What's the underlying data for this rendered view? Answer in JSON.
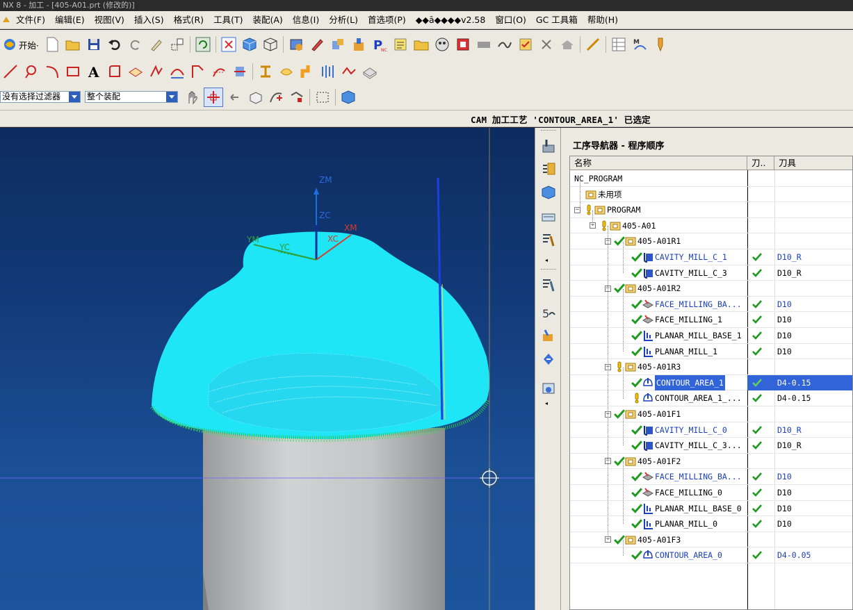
{
  "window": {
    "title": "NX 8 - 加工 - [405-A01.prt (修改的)]"
  },
  "menu": [
    "文件(F)",
    "编辑(E)",
    "视图(V)",
    "插入(S)",
    "格式(R)",
    "工具(T)",
    "装配(A)",
    "信息(I)",
    "分析(L)",
    "首选项(P)",
    "◆◆ā◆◆◆◆v2.58",
    "窗口(O)",
    "GC 工具箱",
    "帮助(H)"
  ],
  "toolbar": {
    "start_label": "开始·",
    "filter_combo": "没有选择过滤器",
    "assembly_combo": "整个装配"
  },
  "status": {
    "message": "CAM 加工工艺 'CONTOUR_AREA_1' 已选定"
  },
  "viewport": {
    "axis_labels": {
      "zm": "ZM",
      "zc": "ZC",
      "xm": "XM",
      "xc": "XC",
      "ym": "YM",
      "yc": "YC"
    }
  },
  "navigator": {
    "title": "工序导航器 - 程序顺序",
    "columns": [
      "名称",
      "刀..",
      "刀具"
    ],
    "rows": [
      {
        "level": 0,
        "label": "NC_PROGRAM",
        "kind": "root",
        "status": "",
        "check": false,
        "tool": "",
        "blue": false
      },
      {
        "level": 1,
        "label": "未用项",
        "kind": "group",
        "status": "",
        "check": false,
        "tool": "",
        "blue": false
      },
      {
        "level": 1,
        "label": "PROGRAM",
        "kind": "group",
        "status": "warn",
        "check": false,
        "tool": "",
        "blue": false,
        "expander": "−"
      },
      {
        "level": 2,
        "label": "405-A01",
        "kind": "group",
        "status": "warn",
        "check": false,
        "tool": "",
        "blue": false,
        "expander": "−"
      },
      {
        "level": 3,
        "label": "405-A01R1",
        "kind": "group",
        "status": "ok",
        "check": false,
        "tool": "",
        "blue": false,
        "expander": "−"
      },
      {
        "level": 4,
        "label": "CAVITY_MILL_C_1",
        "kind": "cavity",
        "status": "ok",
        "check": true,
        "tool": "D10_R",
        "blue": true
      },
      {
        "level": 4,
        "label": "CAVITY_MILL_C_3",
        "kind": "cavity",
        "status": "ok",
        "check": true,
        "tool": "D10_R",
        "blue": false
      },
      {
        "level": 3,
        "label": "405-A01R2",
        "kind": "group",
        "status": "ok",
        "check": false,
        "tool": "",
        "blue": false,
        "expander": "−"
      },
      {
        "level": 4,
        "label": "FACE_MILLING_BA...",
        "kind": "face",
        "status": "ok",
        "check": true,
        "tool": "D10",
        "blue": true
      },
      {
        "level": 4,
        "label": "FACE_MILLING_1",
        "kind": "face",
        "status": "ok",
        "check": true,
        "tool": "D10",
        "blue": false
      },
      {
        "level": 4,
        "label": "PLANAR_MILL_BASE_1",
        "kind": "planar",
        "status": "ok",
        "check": true,
        "tool": "D10",
        "blue": false
      },
      {
        "level": 4,
        "label": "PLANAR_MILL_1",
        "kind": "planar",
        "status": "ok",
        "check": true,
        "tool": "D10",
        "blue": false
      },
      {
        "level": 3,
        "label": "405-A01R3",
        "kind": "group",
        "status": "warn",
        "check": false,
        "tool": "",
        "blue": false,
        "expander": "−"
      },
      {
        "level": 4,
        "label": "CONTOUR_AREA_1",
        "kind": "contour",
        "status": "ok",
        "check": true,
        "tool": "D4-0.15",
        "blue": false,
        "selected": true
      },
      {
        "level": 4,
        "label": "CONTOUR_AREA_1_...",
        "kind": "contour",
        "status": "warn",
        "check": true,
        "tool": "D4-0.15",
        "blue": false
      },
      {
        "level": 3,
        "label": "405-A01F1",
        "kind": "group",
        "status": "ok",
        "check": false,
        "tool": "",
        "blue": false,
        "expander": "−"
      },
      {
        "level": 4,
        "label": "CAVITY_MILL_C_0",
        "kind": "cavity",
        "status": "ok",
        "check": true,
        "tool": "D10_R",
        "blue": true
      },
      {
        "level": 4,
        "label": "CAVITY_MILL_C_3...",
        "kind": "cavity",
        "status": "ok",
        "check": true,
        "tool": "D10_R",
        "blue": false
      },
      {
        "level": 3,
        "label": "405-A01F2",
        "kind": "group",
        "status": "ok",
        "check": false,
        "tool": "",
        "blue": false,
        "expander": "−"
      },
      {
        "level": 4,
        "label": "FACE_MILLING_BA...",
        "kind": "face",
        "status": "ok",
        "check": true,
        "tool": "D10",
        "blue": true
      },
      {
        "level": 4,
        "label": "FACE_MILLING_0",
        "kind": "face",
        "status": "ok",
        "check": true,
        "tool": "D10",
        "blue": false
      },
      {
        "level": 4,
        "label": "PLANAR_MILL_BASE_0",
        "kind": "planar",
        "status": "ok",
        "check": true,
        "tool": "D10",
        "blue": false
      },
      {
        "level": 4,
        "label": "PLANAR_MILL_0",
        "kind": "planar",
        "status": "ok",
        "check": true,
        "tool": "D10",
        "blue": false
      },
      {
        "level": 3,
        "label": "405-A01F3",
        "kind": "group",
        "status": "ok",
        "check": false,
        "tool": "",
        "blue": false,
        "expander": "−"
      },
      {
        "level": 4,
        "label": "CONTOUR_AREA_0",
        "kind": "contour",
        "status": "ok",
        "check": true,
        "tool": "D4-0.05",
        "blue": true
      }
    ]
  },
  "colors": {
    "check_green": "#1e9a1e",
    "warn_yellow": "#f2c200",
    "selection_blue": "#3163d9",
    "link_blue": "#1a3fbf",
    "toolpath_cyan": "#1ee0f5",
    "part_gray": "#c9cacc"
  }
}
